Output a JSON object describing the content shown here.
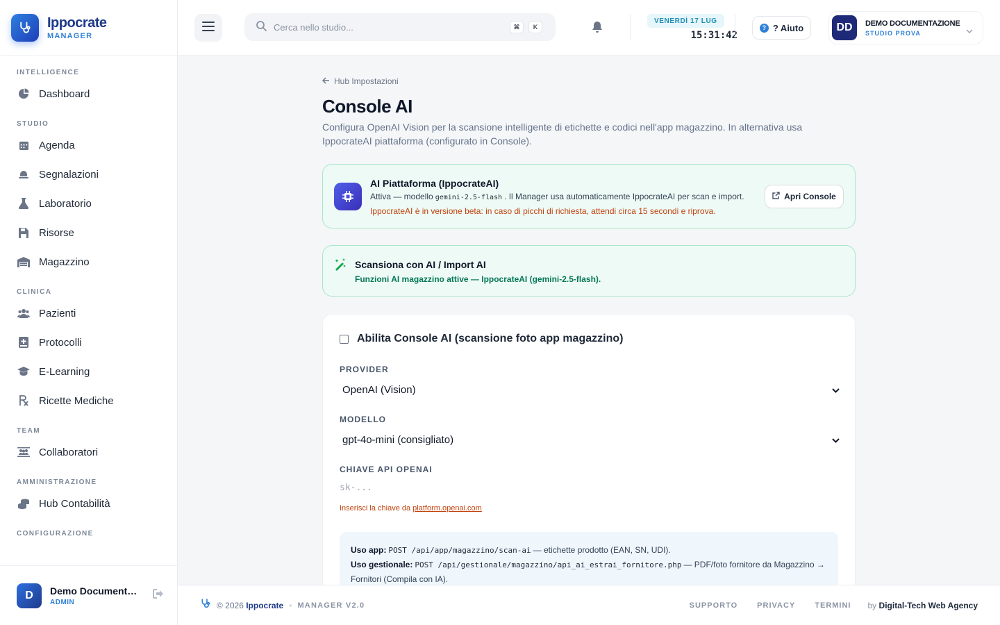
{
  "brand": {
    "name": "Ippocrate",
    "sub": "MANAGER"
  },
  "nav": {
    "sections": [
      {
        "title": "INTELLIGENCE",
        "items": [
          {
            "label": "Dashboard",
            "icon": "pie-chart-icon"
          }
        ]
      },
      {
        "title": "STUDIO",
        "items": [
          {
            "label": "Agenda",
            "icon": "calendar-icon"
          },
          {
            "label": "Segnalazioni",
            "icon": "bell-icon"
          },
          {
            "label": "Laboratorio",
            "icon": "flask-icon"
          },
          {
            "label": "Risorse",
            "icon": "save-icon"
          },
          {
            "label": "Magazzino",
            "icon": "warehouse-icon"
          }
        ]
      },
      {
        "title": "CLINICA",
        "items": [
          {
            "label": "Pazienti",
            "icon": "users-icon"
          },
          {
            "label": "Protocolli",
            "icon": "book-medical-icon"
          },
          {
            "label": "E-Learning",
            "icon": "graduation-cap-icon"
          },
          {
            "label": "Ricette Mediche",
            "icon": "prescription-icon"
          }
        ]
      },
      {
        "title": "TEAM",
        "items": [
          {
            "label": "Collaboratori",
            "icon": "team-icon"
          }
        ]
      },
      {
        "title": "AMMINISTRAZIONE",
        "items": [
          {
            "label": "Hub Contabilità",
            "icon": "coins-icon"
          }
        ]
      },
      {
        "title": "CONFIGURAZIONE",
        "items": []
      }
    ]
  },
  "user": {
    "initial": "D",
    "name": "Demo Documentazione",
    "role": "ADMIN"
  },
  "header": {
    "search_placeholder": "Cerca nello studio...",
    "kbd1": "⌘",
    "kbd2": "K",
    "date": "VENERDÌ 17 LUG",
    "time": "15:31:42",
    "help_label": "? Aiuto",
    "account_initials": "DD",
    "account_name": "DEMO DOCUMENTAZIONE",
    "account_sub": "STUDIO PROVA"
  },
  "page": {
    "back_label": "Hub Impostazioni",
    "title": "Console AI",
    "description": "Configura OpenAI Vision per la scansione intelligente di etichette e codici nell'app magazzino. In alternativa usa IppocrateAI piattaforma (configurato in Console)."
  },
  "platform_card": {
    "title": "AI Piattaforma (IppocrateAI)",
    "line_prefix": "Attiva — modello",
    "model_code": "gemini-2.5-flash",
    "line_suffix": ". Il Manager usa automaticamente IppocrateAI per scan e import.",
    "warning": "IppocrateAI è in versione beta: in caso di picchi di richiesta, attendi circa 15 secondi e riprova.",
    "button_label": "Apri Console"
  },
  "scan_card": {
    "title": "Scansiona con AI / Import AI",
    "subtitle": "Funzioni AI magazzino attive — IppocrateAI (gemini-2.5-flash)."
  },
  "form": {
    "enable_label": "Abilita Console AI (scansione foto app magazzino)",
    "provider_label": "PROVIDER",
    "provider_value": "OpenAI (Vision)",
    "model_label": "MODELLO",
    "model_value": "gpt-4o-mini (consigliato)",
    "api_label": "CHIAVE API OPENAI",
    "api_placeholder": "sk-...",
    "hint_prefix": "Inserisci la chiave da",
    "hint_link": "platform.openai.com",
    "usage": {
      "app_label": "Uso app:",
      "app_code": "POST /api/app/magazzino/scan-ai",
      "app_desc": "— etichette prodotto (EAN, SN, UDI).",
      "gest_label": "Uso gestionale:",
      "gest_code": "POST /api/gestionale/magazzino/api_ai_estrai_fornitore.php",
      "gest_desc": "— PDF/foto fornitore da Magazzino → Fornitori (Compila con IA)."
    }
  },
  "footer": {
    "copy": "© 2026",
    "brand": "Ippocrate",
    "version": "MANAGER V2.0",
    "links": [
      "SUPPORTO",
      "PRIVACY",
      "TERMINI"
    ],
    "by_prefix": "by",
    "by_name": "Digital-Tech Web Agency"
  },
  "colors": {
    "primary": "#1e3a8a",
    "accent": "#2f80d8",
    "success_bg": "#eefaf5",
    "warning": "#c2410c"
  }
}
